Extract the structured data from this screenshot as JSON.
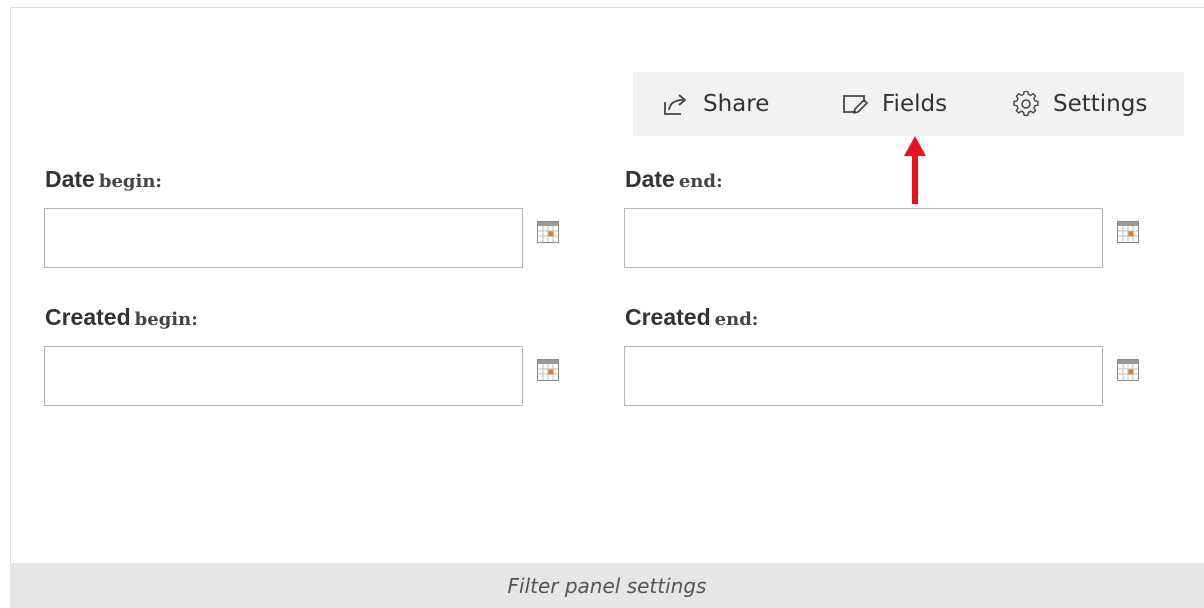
{
  "toolbar": {
    "share_label": "Share",
    "fields_label": "Fields",
    "settings_label": "Settings",
    "icons": {
      "share": "share-icon",
      "fields": "fields-edit-icon",
      "settings": "gear-icon"
    }
  },
  "filters": {
    "date_begin": {
      "label_strong": "Date",
      "label_light": "begin:",
      "value": "",
      "placeholder": ""
    },
    "date_end": {
      "label_strong": "Date",
      "label_light": "end:",
      "value": "",
      "placeholder": ""
    },
    "created_begin": {
      "label_strong": "Created",
      "label_light": "begin:",
      "value": "",
      "placeholder": ""
    },
    "created_end": {
      "label_strong": "Created",
      "label_light": "end:",
      "value": "",
      "placeholder": ""
    },
    "calendar_icon": "calendar-icon"
  },
  "annotation": {
    "arrow_color": "#e8141c",
    "points_to": "fields-button"
  },
  "caption": {
    "text": "Filter panel settings"
  },
  "colors": {
    "toolbar_bg": "#f2f2f2",
    "caption_bg": "#e6e6e6",
    "calendar_accent": "#e07a2c"
  }
}
